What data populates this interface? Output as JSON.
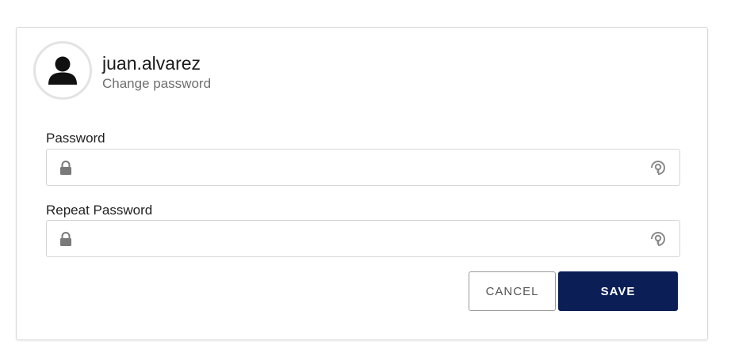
{
  "profile": {
    "username": "juan.alvarez",
    "subtitle": "Change password",
    "avatar_icon": "user-silhouette-icon"
  },
  "form": {
    "password": {
      "label": "Password",
      "value": "",
      "leading_icon": "lock-icon",
      "trailing_icon": "eye-toggle-icon"
    },
    "repeat_password": {
      "label": "Repeat Password",
      "value": "",
      "leading_icon": "lock-icon",
      "trailing_icon": "eye-toggle-icon"
    }
  },
  "actions": {
    "cancel_label": "CANCEL",
    "save_label": "SAVE"
  },
  "colors": {
    "primary": "#0b1f56",
    "icon_gray": "#7a7a7a",
    "border": "#d6d6d6"
  }
}
